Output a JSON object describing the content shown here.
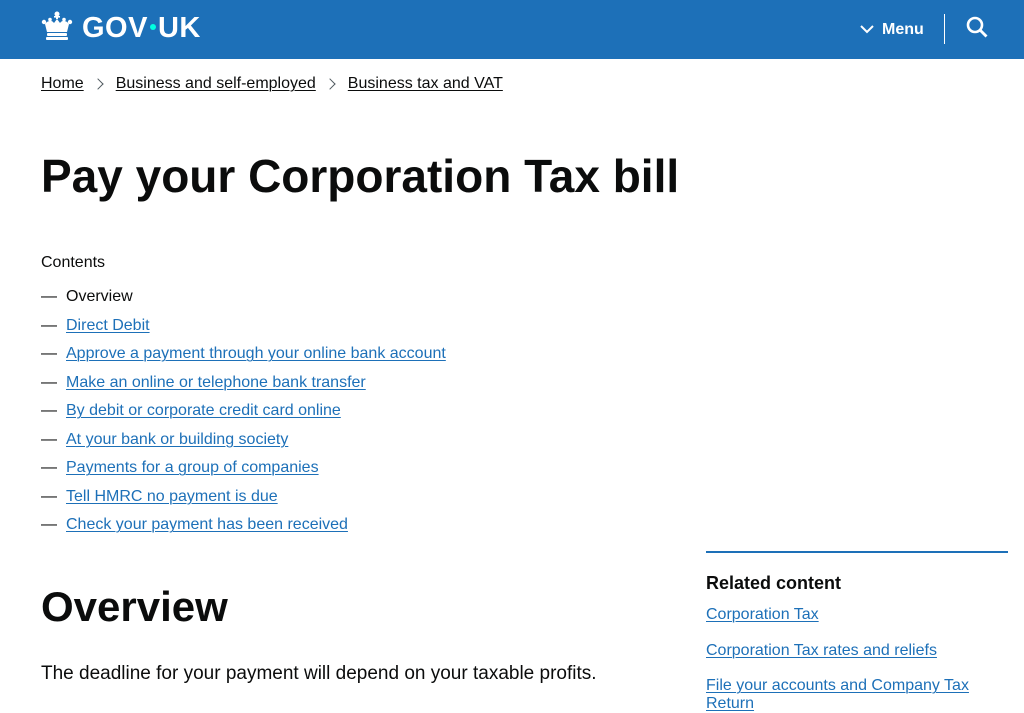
{
  "header": {
    "logo_text_left": "GOV",
    "logo_text_right": "UK",
    "menu_label": "Menu",
    "brand_color": "#1d70b8",
    "icons": [
      "crown-icon",
      "chevron-down-icon",
      "search-icon"
    ]
  },
  "breadcrumbs": [
    {
      "label": "Home"
    },
    {
      "label": "Business and self-employed"
    },
    {
      "label": "Business tax and VAT"
    }
  ],
  "page": {
    "title": "Pay your Corporation Tax bill"
  },
  "contents": {
    "heading": "Contents",
    "items": [
      {
        "label": "Overview",
        "current": true
      },
      {
        "label": "Direct Debit"
      },
      {
        "label": "Approve a payment through your online bank account"
      },
      {
        "label": "Make an online or telephone bank transfer"
      },
      {
        "label": "By debit or corporate credit card online"
      },
      {
        "label": "At your bank or building society"
      },
      {
        "label": "Payments for a group of companies"
      },
      {
        "label": "Tell HMRC no payment is due"
      },
      {
        "label": "Check your payment has been received"
      }
    ]
  },
  "overview": {
    "heading": "Overview",
    "text": "The deadline for your payment will depend on your taxable profits."
  },
  "related": {
    "heading": "Related content",
    "items": [
      {
        "label": "Corporation Tax"
      },
      {
        "label": "Corporation Tax rates and reliefs"
      },
      {
        "label": "File your accounts and Company Tax Return"
      }
    ]
  }
}
